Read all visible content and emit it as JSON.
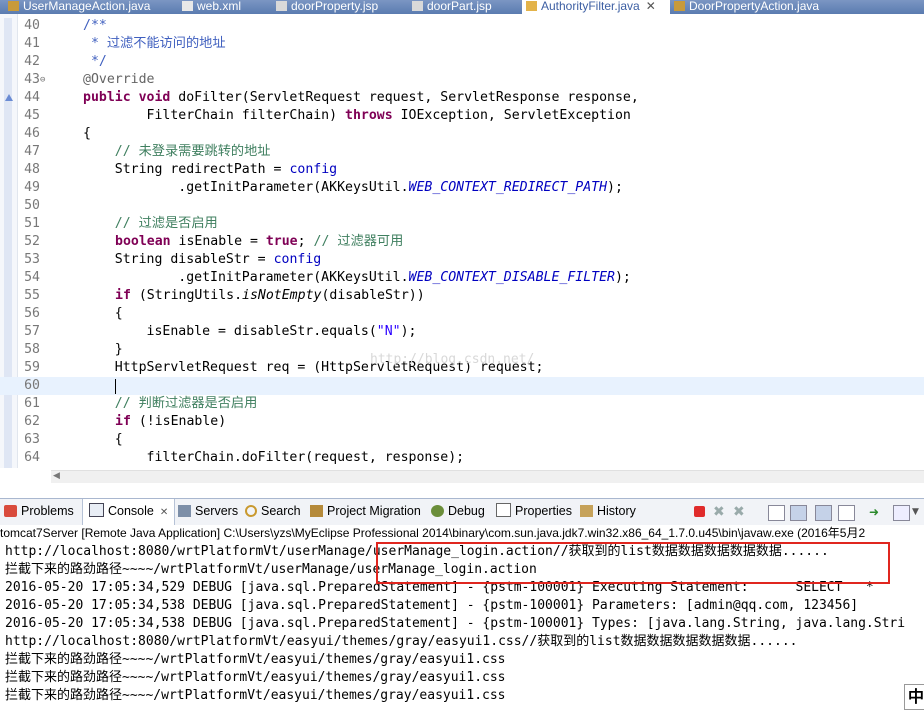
{
  "editor_tabs": [
    {
      "label": "UserManageAction.java"
    },
    {
      "label": "web.xml"
    },
    {
      "label": "doorProperty.jsp"
    },
    {
      "label": "doorPart.jsp"
    },
    {
      "label": "AuthorityFilter.java"
    },
    {
      "label": "DoorPropertyAction.java"
    }
  ],
  "code": {
    "l40": {
      "n": "40",
      "t": "/**"
    },
    "l41": {
      "n": "41",
      "t": " * 过滤不能访问的地址"
    },
    "l42": {
      "n": "42",
      "t": " */"
    },
    "l43": {
      "n": "43",
      "t": "@Override"
    },
    "l44": {
      "n": "44",
      "a": "public void",
      "b": " doFilter(ServletRequest request, ServletResponse response,"
    },
    "l45": {
      "n": "45",
      "a": "        FilterChain filterChain) ",
      "b": "throws",
      "c": " IOException, ServletException"
    },
    "l46": {
      "n": "46",
      "t": "{"
    },
    "l47": {
      "n": "47",
      "t": "    // 未登录需要跳转的地址"
    },
    "l48": {
      "n": "48",
      "a": "    String redirectPath = ",
      "b": "config"
    },
    "l49": {
      "n": "49",
      "a": "            .getInitParameter(AKKeysUtil.",
      "b": "WEB_CONTEXT_REDIRECT_PATH",
      "c": ");"
    },
    "l50": {
      "n": "50",
      "t": ""
    },
    "l51": {
      "n": "51",
      "t": "    // 过滤是否启用"
    },
    "l52": {
      "n": "52",
      "a": "boolean",
      "b": " isEnable = ",
      "c": "true",
      "d": "; ",
      "e": "// 过滤器可用"
    },
    "l53": {
      "n": "53",
      "a": "    String disableStr = ",
      "b": "config"
    },
    "l54": {
      "n": "54",
      "a": "            .getInitParameter(AKKeysUtil.",
      "b": "WEB_CONTEXT_DISABLE_FILTER",
      "c": ");"
    },
    "l55": {
      "n": "55",
      "a": "if",
      "b": " (StringUtils.",
      "c": "isNotEmpty",
      "d": "(disableStr))"
    },
    "l56": {
      "n": "56",
      "t": "    {"
    },
    "l57": {
      "n": "57",
      "a": "        isEnable = disableStr.equals(",
      "b": "\"N\"",
      "c": ");"
    },
    "l58": {
      "n": "58",
      "t": "    }"
    },
    "l59": {
      "n": "59",
      "t": "    HttpServletRequest req = (HttpServletRequest) request;"
    },
    "l60": {
      "n": "60",
      "t": ""
    },
    "l61": {
      "n": "61",
      "t": "    // 判断过滤器是否启用"
    },
    "l62": {
      "n": "62",
      "a": "if",
      "b": " (!isEnable)"
    },
    "l63": {
      "n": "63",
      "t": "    {"
    },
    "l64": {
      "n": "64",
      "t": "        filterChain.doFilter(request, response);"
    }
  },
  "watermark": "http://blog.csdn.net/",
  "view_tabs": [
    {
      "label": "Problems"
    },
    {
      "label": "Console"
    },
    {
      "label": "Servers"
    },
    {
      "label": "Search"
    },
    {
      "label": "Project Migration"
    },
    {
      "label": "Debug"
    },
    {
      "label": "Properties"
    },
    {
      "label": "History"
    }
  ],
  "console_title": "tomcat7Server [Remote Java Application] C:\\Users\\yzs\\MyEclipse Professional 2014\\binary\\com.sun.java.jdk7.win32.x86_64_1.7.0.u45\\bin\\javaw.exe (2016年5月2",
  "console_lines": [
    "http://localhost:8080/wrtPlatformVt/userManage/userManage_login.action//获取到的list数据数据数据数据数据......",
    "拦截下来的路劲路径~~~~/wrtPlatformVt/userManage/userManage_login.action",
    "2016-05-20 17:05:34,529 DEBUG [java.sql.PreparedStatement] - {pstm-100001} Executing Statement:      SELECT   *",
    "2016-05-20 17:05:34,538 DEBUG [java.sql.PreparedStatement] - {pstm-100001} Parameters: [admin@qq.com, 123456]",
    "2016-05-20 17:05:34,538 DEBUG [java.sql.PreparedStatement] - {pstm-100001} Types: [java.lang.String, java.lang.Stri",
    "http://localhost:8080/wrtPlatformVt/easyui/themes/gray/easyui1.css//获取到的list数据数据数据数据数据......",
    "拦截下来的路劲路径~~~~/wrtPlatformVt/easyui/themes/gray/easyui1.css",
    "拦截下来的路劲路径~~~~/wrtPlatformVt/easyui/themes/gray/easyui1.css",
    "拦截下来的路劲路径~~~~/wrtPlatformVt/easyui/themes/gray/easyui1.css"
  ],
  "ime_label": "中"
}
